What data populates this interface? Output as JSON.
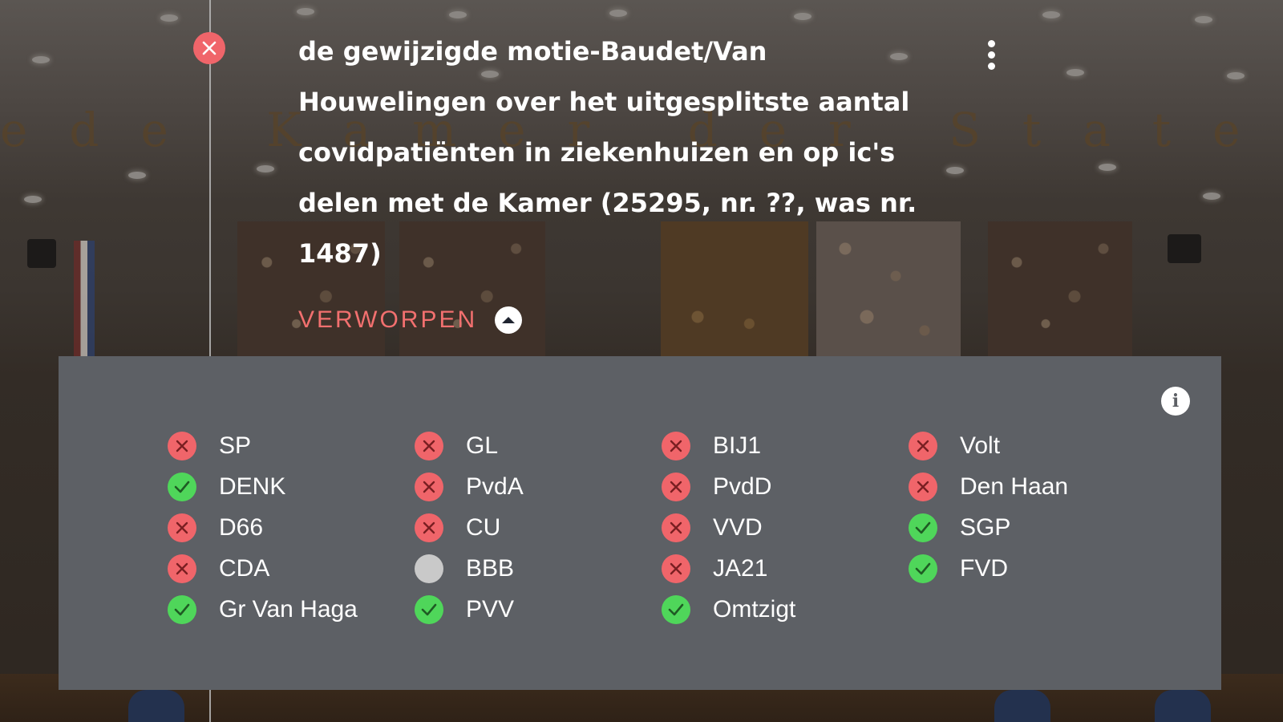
{
  "motion": {
    "status": "rejected",
    "title": "de gewijzigde motie-Baudet/Van Houwelingen over het uitgesplitste aantal covidpatiënten in ziekenhuizen en op ic's delen met de Kamer (25295, nr. ??, was nr. 1487)",
    "result_label": "VERWORPEN"
  },
  "background": {
    "wall_lettering": "ede Kamer der Staten-Genera"
  },
  "votes": {
    "columns": [
      [
        {
          "party": "SP",
          "vote": "against"
        },
        {
          "party": "DENK",
          "vote": "for"
        },
        {
          "party": "D66",
          "vote": "against"
        },
        {
          "party": "CDA",
          "vote": "against"
        },
        {
          "party": "Gr Van Haga",
          "vote": "for"
        }
      ],
      [
        {
          "party": "GL",
          "vote": "against"
        },
        {
          "party": "PvdA",
          "vote": "against"
        },
        {
          "party": "CU",
          "vote": "against"
        },
        {
          "party": "BBB",
          "vote": "none"
        },
        {
          "party": "PVV",
          "vote": "for"
        }
      ],
      [
        {
          "party": "BIJ1",
          "vote": "against"
        },
        {
          "party": "PvdD",
          "vote": "against"
        },
        {
          "party": "VVD",
          "vote": "against"
        },
        {
          "party": "JA21",
          "vote": "against"
        },
        {
          "party": "Omtzigt",
          "vote": "for"
        }
      ],
      [
        {
          "party": "Volt",
          "vote": "against"
        },
        {
          "party": "Den Haan",
          "vote": "against"
        },
        {
          "party": "SGP",
          "vote": "for"
        },
        {
          "party": "FVD",
          "vote": "for"
        }
      ]
    ]
  },
  "icons": {
    "status": "close-icon",
    "more": "more-vertical-icon",
    "collapse": "chevron-up-icon",
    "info": "info-icon",
    "vote_for": "check-icon",
    "vote_against": "close-icon",
    "vote_none": "circle-icon"
  },
  "colors": {
    "against": "#f0656a",
    "for": "#4fd65a",
    "none": "#c9c9c9",
    "result_label": "#f2706f",
    "panel": "#5d6065"
  }
}
